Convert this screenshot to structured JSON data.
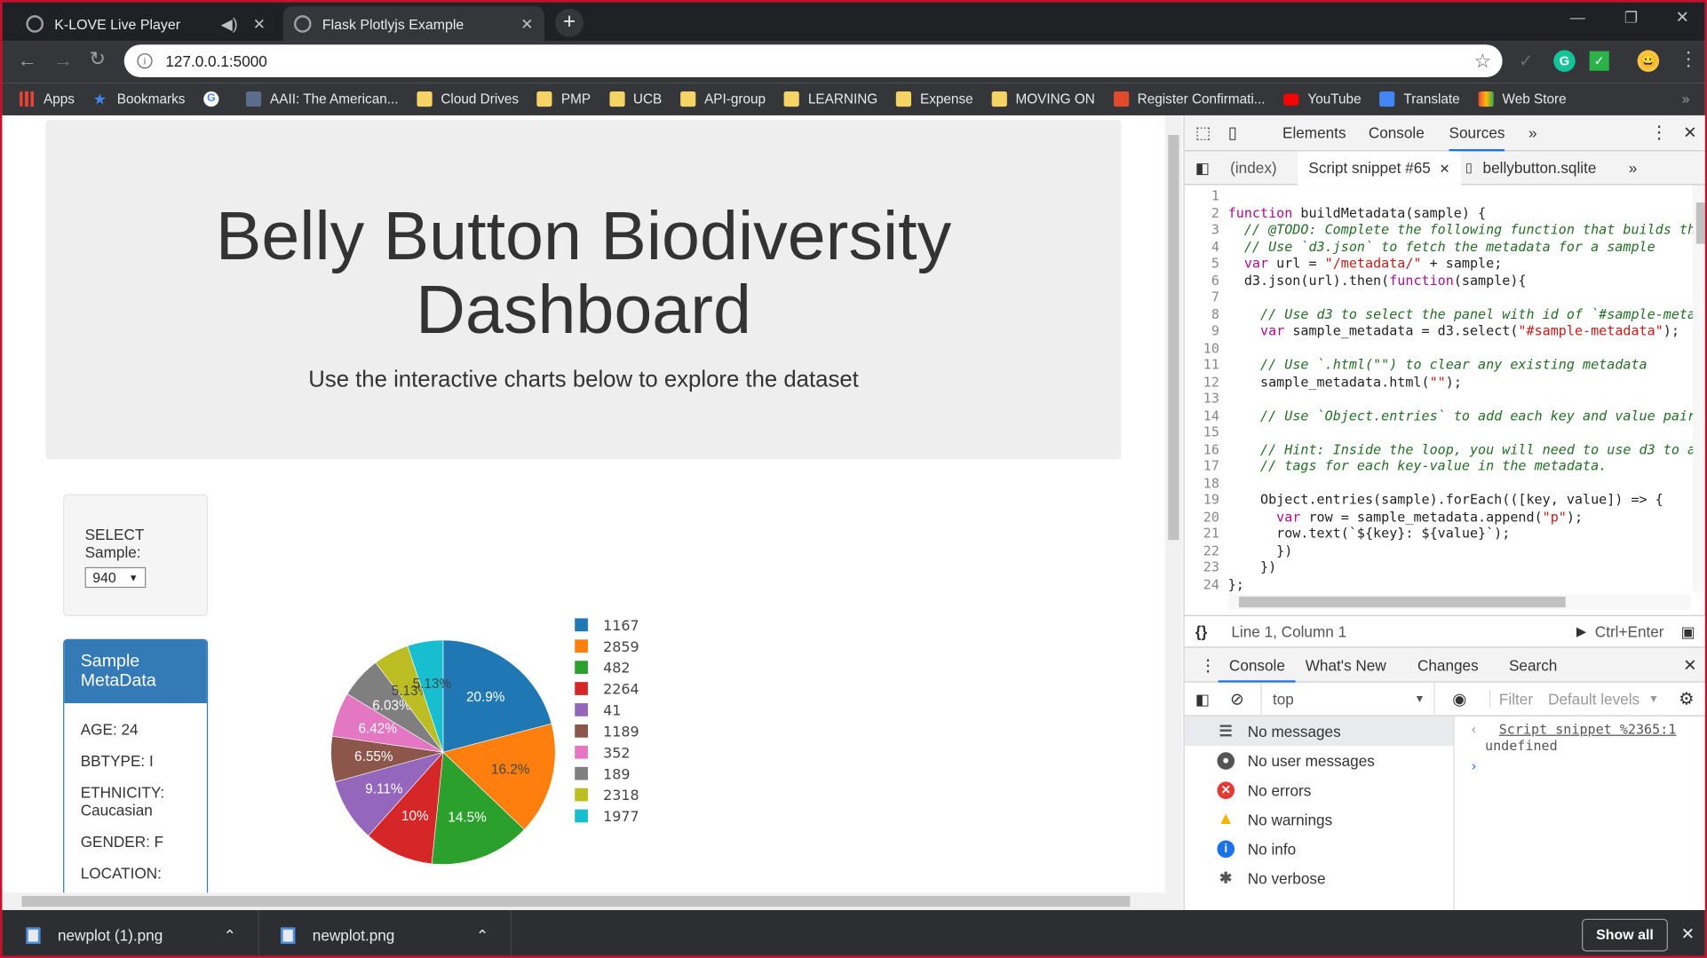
{
  "browser": {
    "tabs": [
      {
        "title": "K-LOVE Live Player"
      },
      {
        "title": "Flask Plotlyjs Example"
      }
    ],
    "new_tab": "+",
    "url": "127.0.0.1:5000",
    "bookmarks": [
      "Apps",
      "Bookmarks",
      "AAII: The American...",
      "Cloud Drives",
      "PMP",
      "UCB",
      "API-group",
      "LEARNING",
      "Expense",
      "MOVING ON",
      "Register Confirmati...",
      "YouTube",
      "Translate",
      "Web Store"
    ],
    "more": "»"
  },
  "page": {
    "title": "Belly Button Biodiversity Dashboard",
    "subtitle": "Use the interactive charts below to explore the dataset",
    "select_label": "SELECT Sample:",
    "select_value": "940",
    "metadata_title": "Sample MetaData",
    "metadata": [
      "AGE: 24",
      "BBTYPE: I",
      "ETHNICITY: Caucasian",
      "GENDER: F",
      "LOCATION:"
    ]
  },
  "chart_data": {
    "type": "pie",
    "labels": [
      "1167",
      "2859",
      "482",
      "2264",
      "41",
      "1189",
      "352",
      "189",
      "2318",
      "1977"
    ],
    "values": [
      20.9,
      16.2,
      14.5,
      10,
      9.11,
      6.55,
      6.42,
      6.03,
      5.13,
      5.13
    ],
    "slice_text": [
      "20.9%",
      "16.2%",
      "14.5%",
      "10%",
      "9.11%",
      "6.55%",
      "6.42%",
      "6.03%",
      "5.13%",
      "5.13%"
    ],
    "colors": [
      "#1f77b4",
      "#ff7f0e",
      "#2ca02c",
      "#d62728",
      "#9467bd",
      "#8c564b",
      "#e377c2",
      "#7f7f7f",
      "#bcbd22",
      "#17becf"
    ],
    "legend": "right"
  },
  "devtools": {
    "tabs": [
      "Elements",
      "Console",
      "Sources"
    ],
    "files": [
      "(index)",
      "Script snippet #65",
      "bellybutton.sqlite"
    ],
    "code_lines": [
      "",
      "function buildMetadata(sample) {",
      "  // @TODO: Complete the following function that builds th",
      "  // Use `d3.json` to fetch the metadata for a sample",
      "  var url = \"/metadata/\" + sample;",
      "  d3.json(url).then(function(sample){",
      "",
      "    // Use d3 to select the panel with id of `#sample-meta",
      "    var sample_metadata = d3.select(\"#sample-metadata\");",
      "",
      "    // Use `.html(\"\") to clear any existing metadata",
      "    sample_metadata.html(\"\");",
      "",
      "    // Use `Object.entries` to add each key and value pair",
      "",
      "    // Hint: Inside the loop, you will need to use d3 to a",
      "    // tags for each key-value in the metadata.",
      "",
      "    Object.entries(sample).forEach(([key, value]) => {",
      "      var row = sample_metadata.append(\"p\");",
      "      row.text(`${key}: ${value}`);",
      "      })",
      "    })",
      "};",
      ""
    ],
    "cursor": "Line 1, Column 1",
    "run_hint": "Ctrl+Enter",
    "drawer_tabs": [
      "Console",
      "What's New",
      "Changes",
      "Search"
    ],
    "context": "top",
    "filter_placeholder": "Filter",
    "levels": "Default levels",
    "messages": [
      "No messages",
      "No user messages",
      "No errors",
      "No warnings",
      "No info",
      "No verbose"
    ],
    "output_link": "Script snippet %2365:1",
    "output_value": "undefined"
  },
  "downloads": {
    "files": [
      "newplot (1).png",
      "newplot.png"
    ],
    "show_all": "Show all"
  }
}
